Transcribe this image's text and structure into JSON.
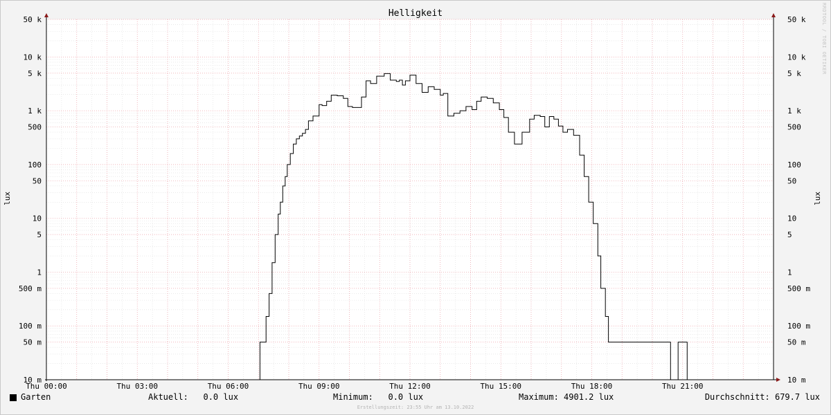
{
  "chart_data": {
    "type": "line",
    "title": "Helligkeit",
    "ylabel": "lux",
    "yscale": "log",
    "ylim": [
      0.01,
      50000
    ],
    "xlim": [
      0,
      24
    ],
    "grid": true,
    "y_ticks": [
      {
        "value": 50000,
        "label": "50 k"
      },
      {
        "value": 10000,
        "label": "10 k"
      },
      {
        "value": 5000,
        "label": "5 k"
      },
      {
        "value": 1000,
        "label": "1 k"
      },
      {
        "value": 500,
        "label": "500"
      },
      {
        "value": 100,
        "label": "100"
      },
      {
        "value": 50,
        "label": "50"
      },
      {
        "value": 10,
        "label": "10"
      },
      {
        "value": 5,
        "label": "5"
      },
      {
        "value": 1,
        "label": "1"
      },
      {
        "value": 0.5,
        "label": "500 m"
      },
      {
        "value": 0.1,
        "label": "100 m"
      },
      {
        "value": 0.05,
        "label": "50 m"
      },
      {
        "value": 0.01,
        "label": "10 m"
      }
    ],
    "x_ticks": [
      {
        "value": 0,
        "label": "Thu 00:00"
      },
      {
        "value": 3,
        "label": "Thu 03:00"
      },
      {
        "value": 6,
        "label": "Thu 06:00"
      },
      {
        "value": 9,
        "label": "Thu 09:00"
      },
      {
        "value": 12,
        "label": "Thu 12:00"
      },
      {
        "value": 15,
        "label": "Thu 15:00"
      },
      {
        "value": 18,
        "label": "Thu 18:00"
      },
      {
        "value": 21,
        "label": "Thu 21:00"
      }
    ],
    "series": [
      {
        "name": "Garten",
        "color": "#000000",
        "x": [
          0,
          7.05,
          7.05,
          7.25,
          7.35,
          7.45,
          7.55,
          7.65,
          7.72,
          7.8,
          7.88,
          7.95,
          8.05,
          8.15,
          8.25,
          8.35,
          8.45,
          8.55,
          8.65,
          8.8,
          9.0,
          9.1,
          9.25,
          9.4,
          9.6,
          9.8,
          9.95,
          10.1,
          10.4,
          10.55,
          10.7,
          10.9,
          11.15,
          11.35,
          11.55,
          11.65,
          11.75,
          11.85,
          12.0,
          12.2,
          12.4,
          12.6,
          12.8,
          13.0,
          13.1,
          13.25,
          13.45,
          13.65,
          13.85,
          14.05,
          14.2,
          14.35,
          14.55,
          14.75,
          14.95,
          15.1,
          15.25,
          15.45,
          15.7,
          15.95,
          16.1,
          16.3,
          16.45,
          16.6,
          16.75,
          16.9,
          17.05,
          17.2,
          17.4,
          17.6,
          17.75,
          17.9,
          18.05,
          18.2,
          18.3,
          18.45,
          18.55,
          18.65,
          18.75,
          18.85,
          18.95,
          19.05,
          19.15,
          19.25,
          19.35,
          19.45,
          19.55,
          19.65,
          19.78,
          20.6,
          20.6,
          20.85,
          20.85,
          21.15,
          21.15,
          24
        ],
        "values": [
          0.01,
          0.01,
          0.05,
          0.15,
          0.4,
          1.5,
          5,
          12,
          20,
          40,
          60,
          100,
          160,
          240,
          300,
          340,
          380,
          450,
          650,
          800,
          1300,
          1250,
          1500,
          1950,
          1900,
          1700,
          1200,
          1150,
          1800,
          3600,
          3200,
          4400,
          4901.2,
          3700,
          3500,
          3700,
          3000,
          3600,
          4600,
          3200,
          2200,
          2800,
          2500,
          1950,
          2100,
          800,
          900,
          1000,
          1200,
          1050,
          1500,
          1800,
          1700,
          1400,
          1050,
          750,
          400,
          240,
          400,
          700,
          820,
          780,
          500,
          780,
          700,
          520,
          400,
          450,
          350,
          150,
          60,
          20,
          8,
          2,
          0.5,
          0.15,
          0.05,
          0.05,
          0.05,
          0.05,
          0.05,
          0.05,
          0.05,
          0.05,
          0.05,
          0.05,
          0.05,
          0.05,
          0.05,
          0.05,
          0.01,
          0.01,
          0.05,
          0.05,
          0.01,
          0.01
        ]
      }
    ]
  },
  "legend": {
    "series_name": "Garten",
    "current": "Aktuell:   0.0 lux",
    "minimum": "Minimum:   0.0 lux",
    "maximum": "Maximum: 4901.2 lux",
    "average": "Durchschnitt: 679.7 lux"
  },
  "footer": {
    "created": "Erstellungszeit: 23:55 Uhr am 13.10.2022",
    "watermark": "RRDTOOL / TOBI OETIKER"
  }
}
